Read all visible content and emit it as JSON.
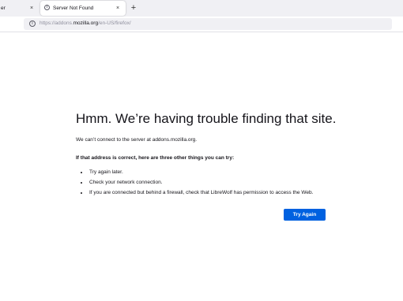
{
  "browser": {
    "tabs": [
      {
        "label": "er",
        "active": false
      },
      {
        "label": "Server Not Found",
        "active": true
      }
    ],
    "tab_close_glyph": "×",
    "new_tab_glyph": "+",
    "url": {
      "prefix": "https://addons.",
      "host": "mozilla.org",
      "path": "/en-US/firefox/"
    },
    "icons": {
      "tab_icon": "info-icon",
      "url_icon": "info-icon",
      "bookmark": "star-icon"
    }
  },
  "error_page": {
    "title": "Hmm. We’re having trouble finding that site.",
    "description": "We can’t connect to the server at addons.mozilla.org.",
    "subheading": "If that address is correct, here are three other things you can try:",
    "tips": [
      "Try again later.",
      "Check your network connection.",
      "If you are connected but behind a firewall, check that LibreWolf has permission to access the Web."
    ],
    "try_again_label": "Try Again"
  },
  "colors": {
    "accent": "#0061e0",
    "tab_strip": "#f0f0f4",
    "text": "#15141a"
  }
}
